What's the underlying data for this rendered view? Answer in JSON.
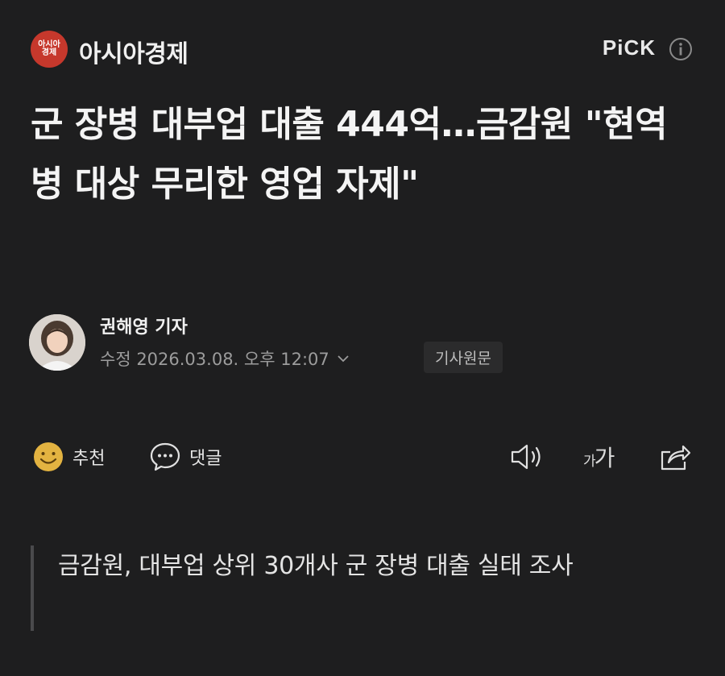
{
  "press": {
    "logo_line1": "아시아",
    "logo_line2": "경제",
    "name": "아시아경제",
    "pick_label": "PiCK"
  },
  "article": {
    "headline": "군 장병 대부업 대출 444억…금감원 \"현역병 대상 무리한 영업 자제\"",
    "reporter": "권해영 기자",
    "modified": "수정 2026.03.08. 오후 12:07",
    "original_label": "기사원문",
    "summary": "금감원, 대부업 상위 30개사 군 장병 대출 실태 조사"
  },
  "actions": {
    "like_label": "추천",
    "comment_label": "댓글",
    "font_small": "가",
    "font_large": "가"
  },
  "icons": {
    "info": "info-icon",
    "like": "smile-emoji-icon",
    "comment": "speech-bubble-icon",
    "tts": "speaker-icon",
    "share": "share-icon"
  },
  "colors": {
    "background": "#1e1e1f",
    "logo": "#c6382c",
    "emoji": "#e3b341"
  }
}
